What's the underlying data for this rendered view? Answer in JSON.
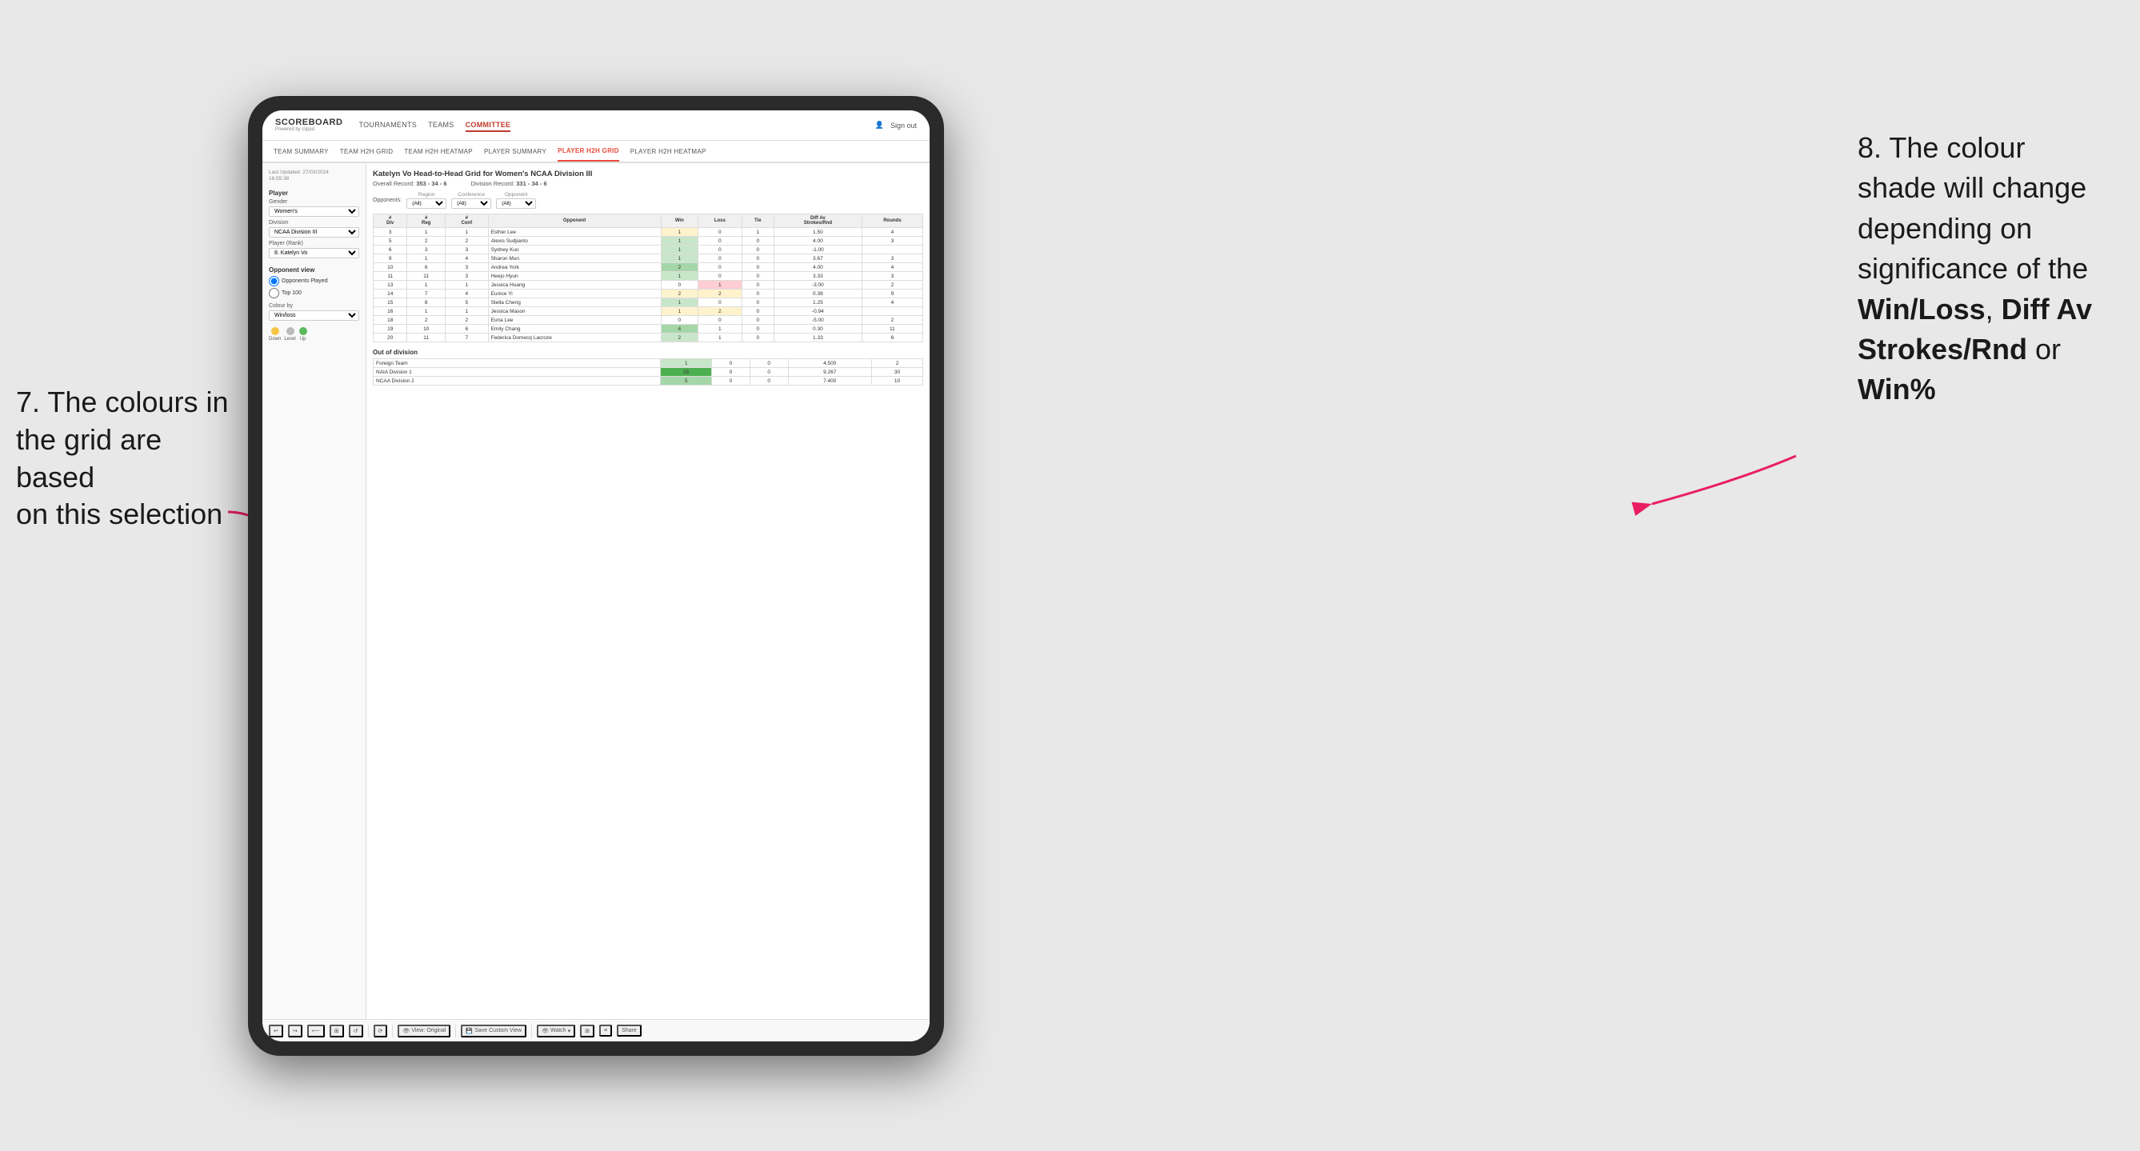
{
  "annotations": {
    "left_text_line1": "7. The colours in",
    "left_text_line2": "the grid are based",
    "left_text_line3": "on this selection",
    "right_text_line1": "8. The colour",
    "right_text_line2": "shade will change",
    "right_text_line3": "depending on",
    "right_text_line4": "significance of the",
    "right_text_bold1": "Win/Loss",
    "right_text_comma": ", ",
    "right_text_bold2": "Diff Av",
    "right_text_line5": "Strokes/Rnd",
    "right_text_or": " or",
    "right_text_bold3": "Win%"
  },
  "nav": {
    "logo": "SCOREBOARD",
    "logo_sub": "Powered by clippd",
    "items": [
      "TOURNAMENTS",
      "TEAMS",
      "COMMITTEE"
    ],
    "sign_out": "Sign out"
  },
  "sub_nav": {
    "items": [
      "TEAM SUMMARY",
      "TEAM H2H GRID",
      "TEAM H2H HEATMAP",
      "PLAYER SUMMARY",
      "PLAYER H2H GRID",
      "PLAYER H2H HEATMAP"
    ]
  },
  "sidebar": {
    "last_updated_label": "Last Updated: 27/03/2024",
    "last_updated_time": "16:55:38",
    "player_label": "Player",
    "gender_label": "Gender",
    "gender_value": "Women's",
    "division_label": "Division",
    "division_value": "NCAA Division III",
    "player_rank_label": "Player (Rank)",
    "player_rank_value": "8. Katelyn Vo",
    "opponent_view_label": "Opponent view",
    "radio1": "Opponents Played",
    "radio2": "Top 100",
    "colour_by_label": "Colour by",
    "colour_by_value": "Win/loss",
    "legend": {
      "down_label": "Down",
      "level_label": "Level",
      "up_label": "Up"
    }
  },
  "grid": {
    "title": "Katelyn Vo Head-to-Head Grid for Women's NCAA Division III",
    "overall_record_label": "Overall Record:",
    "overall_record_value": "353 - 34 - 6",
    "division_record_label": "Division Record:",
    "division_record_value": "331 - 34 - 6",
    "filter_opponents_label": "Opponents:",
    "filter_region_label": "Region",
    "filter_region_value": "(All)",
    "filter_conference_label": "Conference",
    "filter_conference_value": "(All)",
    "filter_opponent_label": "Opponent",
    "filter_opponent_value": "(All)",
    "table_headers": [
      "#\nDiv",
      "#\nReg",
      "#\nConf",
      "Opponent",
      "Win",
      "Loss",
      "Tie",
      "Diff Av\nStrokes/Rnd",
      "Rounds"
    ],
    "rows": [
      {
        "div": "3",
        "reg": "1",
        "conf": "1",
        "opponent": "Esther Lee",
        "win": "1",
        "loss": "0",
        "tie": "1",
        "diff": "1.50",
        "rounds": "4",
        "win_color": "yellow",
        "loss_color": "white"
      },
      {
        "div": "5",
        "reg": "2",
        "conf": "2",
        "opponent": "Alexis Sudjianto",
        "win": "1",
        "loss": "0",
        "tie": "0",
        "diff": "4.00",
        "rounds": "3",
        "win_color": "green-light",
        "loss_color": "white"
      },
      {
        "div": "6",
        "reg": "3",
        "conf": "3",
        "opponent": "Sydney Kuo",
        "win": "1",
        "loss": "0",
        "tie": "0",
        "diff": "-1.00",
        "rounds": "",
        "win_color": "green-light",
        "loss_color": "white"
      },
      {
        "div": "9",
        "reg": "1",
        "conf": "4",
        "opponent": "Sharon Mun",
        "win": "1",
        "loss": "0",
        "tie": "0",
        "diff": "3.67",
        "rounds": "3",
        "win_color": "green-light",
        "loss_color": "white"
      },
      {
        "div": "10",
        "reg": "6",
        "conf": "3",
        "opponent": "Andrea York",
        "win": "2",
        "loss": "0",
        "tie": "0",
        "diff": "4.00",
        "rounds": "4",
        "win_color": "green-mid",
        "loss_color": "white"
      },
      {
        "div": "11",
        "reg": "11",
        "conf": "3",
        "opponent": "Heejo Hyun",
        "win": "1",
        "loss": "0",
        "tie": "0",
        "diff": "3.33",
        "rounds": "3",
        "win_color": "green-light",
        "loss_color": "white"
      },
      {
        "div": "13",
        "reg": "1",
        "conf": "1",
        "opponent": "Jessica Huang",
        "win": "0",
        "loss": "1",
        "tie": "0",
        "diff": "-3.00",
        "rounds": "2",
        "win_color": "white",
        "loss_color": "red-light"
      },
      {
        "div": "14",
        "reg": "7",
        "conf": "4",
        "opponent": "Eunice Yi",
        "win": "2",
        "loss": "2",
        "tie": "0",
        "diff": "0.38",
        "rounds": "9",
        "win_color": "yellow",
        "loss_color": "yellow"
      },
      {
        "div": "15",
        "reg": "8",
        "conf": "5",
        "opponent": "Stella Cheng",
        "win": "1",
        "loss": "0",
        "tie": "0",
        "diff": "1.25",
        "rounds": "4",
        "win_color": "green-light",
        "loss_color": "white"
      },
      {
        "div": "16",
        "reg": "1",
        "conf": "1",
        "opponent": "Jessica Mason",
        "win": "1",
        "loss": "2",
        "tie": "0",
        "diff": "-0.94",
        "rounds": "",
        "win_color": "yellow",
        "loss_color": "yellow"
      },
      {
        "div": "18",
        "reg": "2",
        "conf": "2",
        "opponent": "Euna Lee",
        "win": "0",
        "loss": "0",
        "tie": "0",
        "diff": "-5.00",
        "rounds": "2",
        "win_color": "white",
        "loss_color": "white"
      },
      {
        "div": "19",
        "reg": "10",
        "conf": "6",
        "opponent": "Emily Chang",
        "win": "4",
        "loss": "1",
        "tie": "0",
        "diff": "0.30",
        "rounds": "11",
        "win_color": "green-mid",
        "loss_color": "white"
      },
      {
        "div": "20",
        "reg": "11",
        "conf": "7",
        "opponent": "Federica Domecq Lacroze",
        "win": "2",
        "loss": "1",
        "tie": "0",
        "diff": "1.33",
        "rounds": "6",
        "win_color": "green-light",
        "loss_color": "white"
      }
    ],
    "out_of_division_label": "Out of division",
    "out_of_division_rows": [
      {
        "label": "Foreign Team",
        "win": "1",
        "loss": "0",
        "tie": "0",
        "diff": "4.500",
        "rounds": "2",
        "win_color": "green-light"
      },
      {
        "label": "NAIA Division 1",
        "win": "15",
        "loss": "0",
        "tie": "0",
        "diff": "9.267",
        "rounds": "30",
        "win_color": "green-dark"
      },
      {
        "label": "NCAA Division 2",
        "win": "5",
        "loss": "0",
        "tie": "0",
        "diff": "7.400",
        "rounds": "10",
        "win_color": "green-mid"
      }
    ]
  },
  "toolbar": {
    "view_original": "View: Original",
    "save_custom_view": "Save Custom View",
    "watch": "Watch",
    "share": "Share"
  }
}
